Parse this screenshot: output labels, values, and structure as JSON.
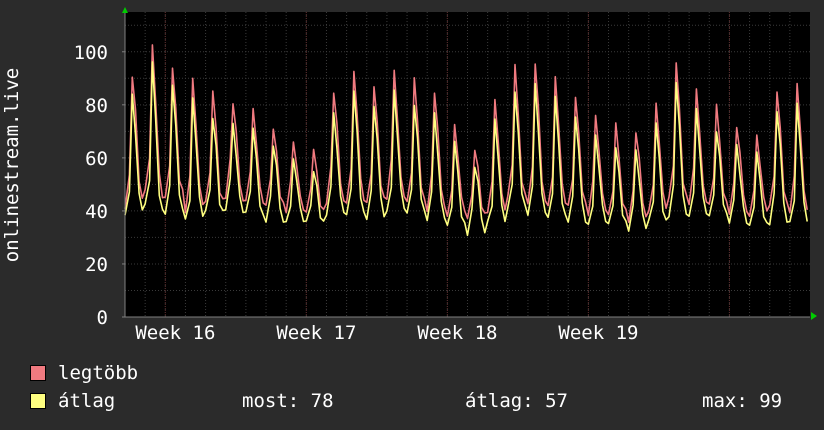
{
  "chart_data": {
    "type": "line",
    "ylabel": "onlinestream.live",
    "ylim": [
      0,
      115
    ],
    "yticks": [
      0,
      20,
      40,
      60,
      80,
      100
    ],
    "xtick_labels": [
      "Week 16",
      "Week 17",
      "Week 18",
      "Week 19"
    ],
    "grid": true,
    "days": 34,
    "series": [
      {
        "name": "legtöbb",
        "color": "#f07a80",
        "values": [
          [
            42,
            53,
            91,
            77,
            51,
            46
          ],
          [
            48,
            61,
            102,
            82,
            53,
            45
          ],
          [
            44,
            57,
            95,
            78,
            52,
            47
          ],
          [
            40,
            52,
            90,
            74,
            49,
            43
          ],
          [
            43,
            55,
            84,
            71,
            48,
            44
          ],
          [
            46,
            59,
            81,
            69,
            50,
            45
          ],
          [
            44,
            56,
            78,
            66,
            48,
            43
          ],
          [
            41,
            52,
            72,
            62,
            46,
            42
          ],
          [
            40,
            50,
            66,
            58,
            45,
            41
          ],
          [
            39,
            49,
            62,
            55,
            43,
            40
          ],
          [
            44,
            56,
            85,
            72,
            50,
            45
          ],
          [
            43,
            57,
            92,
            77,
            51,
            44
          ],
          [
            42,
            54,
            88,
            73,
            50,
            44
          ],
          [
            45,
            58,
            93,
            76,
            52,
            46
          ],
          [
            43,
            55,
            89,
            74,
            50,
            44
          ],
          [
            41,
            53,
            85,
            70,
            48,
            43
          ],
          [
            38,
            49,
            72,
            61,
            44,
            40
          ],
          [
            36,
            46,
            64,
            56,
            42,
            38
          ],
          [
            40,
            50,
            82,
            68,
            46,
            41
          ],
          [
            45,
            58,
            94,
            76,
            52,
            46
          ],
          [
            44,
            56,
            96,
            78,
            51,
            45
          ],
          [
            42,
            54,
            90,
            73,
            49,
            43
          ],
          [
            41,
            52,
            84,
            69,
            48,
            42
          ],
          [
            39,
            50,
            76,
            64,
            46,
            41
          ],
          [
            38,
            48,
            72,
            60,
            44,
            40
          ],
          [
            37,
            47,
            70,
            59,
            43,
            39
          ],
          [
            40,
            51,
            80,
            66,
            46,
            41
          ],
          [
            44,
            57,
            97,
            78,
            51,
            45
          ],
          [
            43,
            55,
            86,
            71,
            49,
            44
          ],
          [
            42,
            53,
            79,
            66,
            48,
            43
          ],
          [
            40,
            50,
            72,
            61,
            46,
            41
          ],
          [
            38,
            49,
            68,
            58,
            44,
            40
          ],
          [
            41,
            53,
            86,
            71,
            48,
            42
          ],
          [
            40,
            52,
            88,
            72,
            47,
            41
          ]
        ]
      },
      {
        "name": "átlag",
        "color": "#ffff80",
        "values": [
          [
            39,
            46,
            84,
            70,
            46,
            41
          ],
          [
            42,
            52,
            95,
            75,
            47,
            40
          ],
          [
            40,
            49,
            88,
            71,
            46,
            42
          ],
          [
            37,
            45,
            82,
            67,
            44,
            38
          ],
          [
            39,
            48,
            76,
            64,
            43,
            39
          ],
          [
            41,
            51,
            73,
            62,
            45,
            40
          ],
          [
            39,
            48,
            70,
            60,
            43,
            38
          ],
          [
            37,
            45,
            65,
            56,
            41,
            37
          ],
          [
            36,
            43,
            59,
            52,
            40,
            36
          ],
          [
            35,
            42,
            56,
            49,
            38,
            35
          ],
          [
            39,
            48,
            77,
            65,
            45,
            40
          ],
          [
            38,
            49,
            84,
            70,
            46,
            39
          ],
          [
            38,
            47,
            80,
            66,
            45,
            39
          ],
          [
            40,
            50,
            85,
            69,
            47,
            41
          ],
          [
            38,
            48,
            81,
            67,
            45,
            39
          ],
          [
            37,
            46,
            77,
            63,
            43,
            38
          ],
          [
            34,
            42,
            65,
            55,
            39,
            35
          ],
          [
            32,
            40,
            57,
            50,
            37,
            33
          ],
          [
            36,
            43,
            74,
            61,
            41,
            36
          ],
          [
            40,
            50,
            86,
            69,
            47,
            41
          ],
          [
            39,
            48,
            88,
            71,
            46,
            40
          ],
          [
            37,
            47,
            82,
            66,
            44,
            38
          ],
          [
            37,
            45,
            76,
            62,
            43,
            37
          ],
          [
            35,
            43,
            68,
            57,
            41,
            36
          ],
          [
            34,
            42,
            65,
            54,
            39,
            35
          ],
          [
            33,
            41,
            63,
            53,
            38,
            34
          ],
          [
            36,
            44,
            72,
            60,
            41,
            36
          ],
          [
            39,
            49,
            89,
            71,
            46,
            40
          ],
          [
            38,
            48,
            78,
            64,
            44,
            39
          ],
          [
            37,
            46,
            71,
            60,
            43,
            38
          ],
          [
            36,
            43,
            65,
            55,
            41,
            36
          ],
          [
            34,
            42,
            61,
            52,
            39,
            35
          ],
          [
            36,
            46,
            78,
            64,
            43,
            37
          ],
          [
            36,
            45,
            80,
            65,
            42,
            36
          ]
        ]
      }
    ]
  },
  "legend": {
    "max_label": "legtöbb",
    "avg_label": "átlag",
    "stats": {
      "now_label": "most:",
      "now_value": "78",
      "avg_label": "átlag:",
      "avg_value": "57",
      "max_label": "max:",
      "max_value": "99"
    }
  },
  "colors": {
    "background": "#2b2b2b",
    "plot": "#000000",
    "grid": "#3a3a3a",
    "week_line": "#5a2a2a",
    "axis_arrow": "#00cc00"
  }
}
